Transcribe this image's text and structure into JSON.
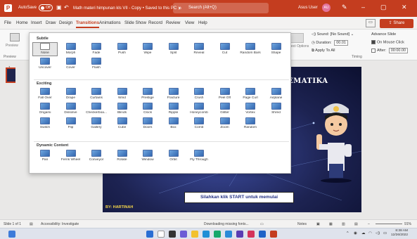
{
  "titlebar": {
    "autosave_label": "AutoSave",
    "autosave_state": "Off",
    "document_title": "Math materi himpunan kls VII - Copy • Saved to this PC ∨",
    "search_placeholder": "Search (Alt+Q)",
    "user_name": "Asus User",
    "user_initials": "AU"
  },
  "menu": {
    "tabs": [
      "File",
      "Home",
      "Insert",
      "Draw",
      "Design",
      "Transitions",
      "Animations",
      "Slide Show",
      "Record",
      "Review",
      "View",
      "Help"
    ],
    "active_tab": "Transitions",
    "comment_icon": "comment-icon",
    "share_label": "Share"
  },
  "ribbon": {
    "preview_label": "Preview",
    "preview_group": "Preview",
    "effect_options_label": "Effect Options",
    "sound_label": "Sound:",
    "sound_value": "[No Sound]",
    "duration_label": "Duration:",
    "duration_value": "00.01",
    "apply_all_label": "Apply To All",
    "advance_label": "Advance Slide",
    "on_click_label": "On Mouse Click",
    "on_click_checked": true,
    "after_label": "After:",
    "after_value": "00:00.00",
    "after_checked": false,
    "timing_group": "Timing"
  },
  "gallery": {
    "subtle_label": "Subtle",
    "subtle": [
      "None",
      "Morph",
      "Fade",
      "Push",
      "Wipe",
      "Split",
      "Reveal",
      "Cut",
      "Random Bars",
      "Shape",
      "Uncover",
      "Cover",
      "Flash"
    ],
    "exciting_label": "Exciting",
    "exciting": [
      "Fall Over",
      "Drape",
      "Curtains",
      "Wind",
      "Prestige",
      "Fracture",
      "Crush",
      "Peel Off",
      "Page Curl",
      "Airplane",
      "Origami",
      "Dissolve",
      "Checkerboa...",
      "Blinds",
      "Clock",
      "Ripple",
      "Honeycomb",
      "Glitter",
      "Vortex",
      "Shred",
      "Switch",
      "Flip",
      "Gallery",
      "Cube",
      "Doors",
      "Box",
      "Comb",
      "Zoom",
      "Random"
    ],
    "dynamic_label": "Dynamic Content",
    "dynamic": [
      "Pan",
      "Ferris Wheel",
      "Conveyor",
      "Rotate",
      "Window",
      "Orbit",
      "Fly Through"
    ],
    "selected": "None"
  },
  "slide": {
    "heading": "EMATIKA",
    "start_text": "Silahkan klik START untuk memulai",
    "credit": "BY: HARTINAH",
    "thumb_number": "1"
  },
  "status": {
    "slide_info": "Slide 1 of 1",
    "accessibility": "Accessibility: Investigate",
    "downloading": "Downloading missing fonts...",
    "notes": "Notes",
    "zoom": "91%"
  },
  "taskbar": {
    "time": "8:38 AM",
    "date": "12/26/2022"
  }
}
